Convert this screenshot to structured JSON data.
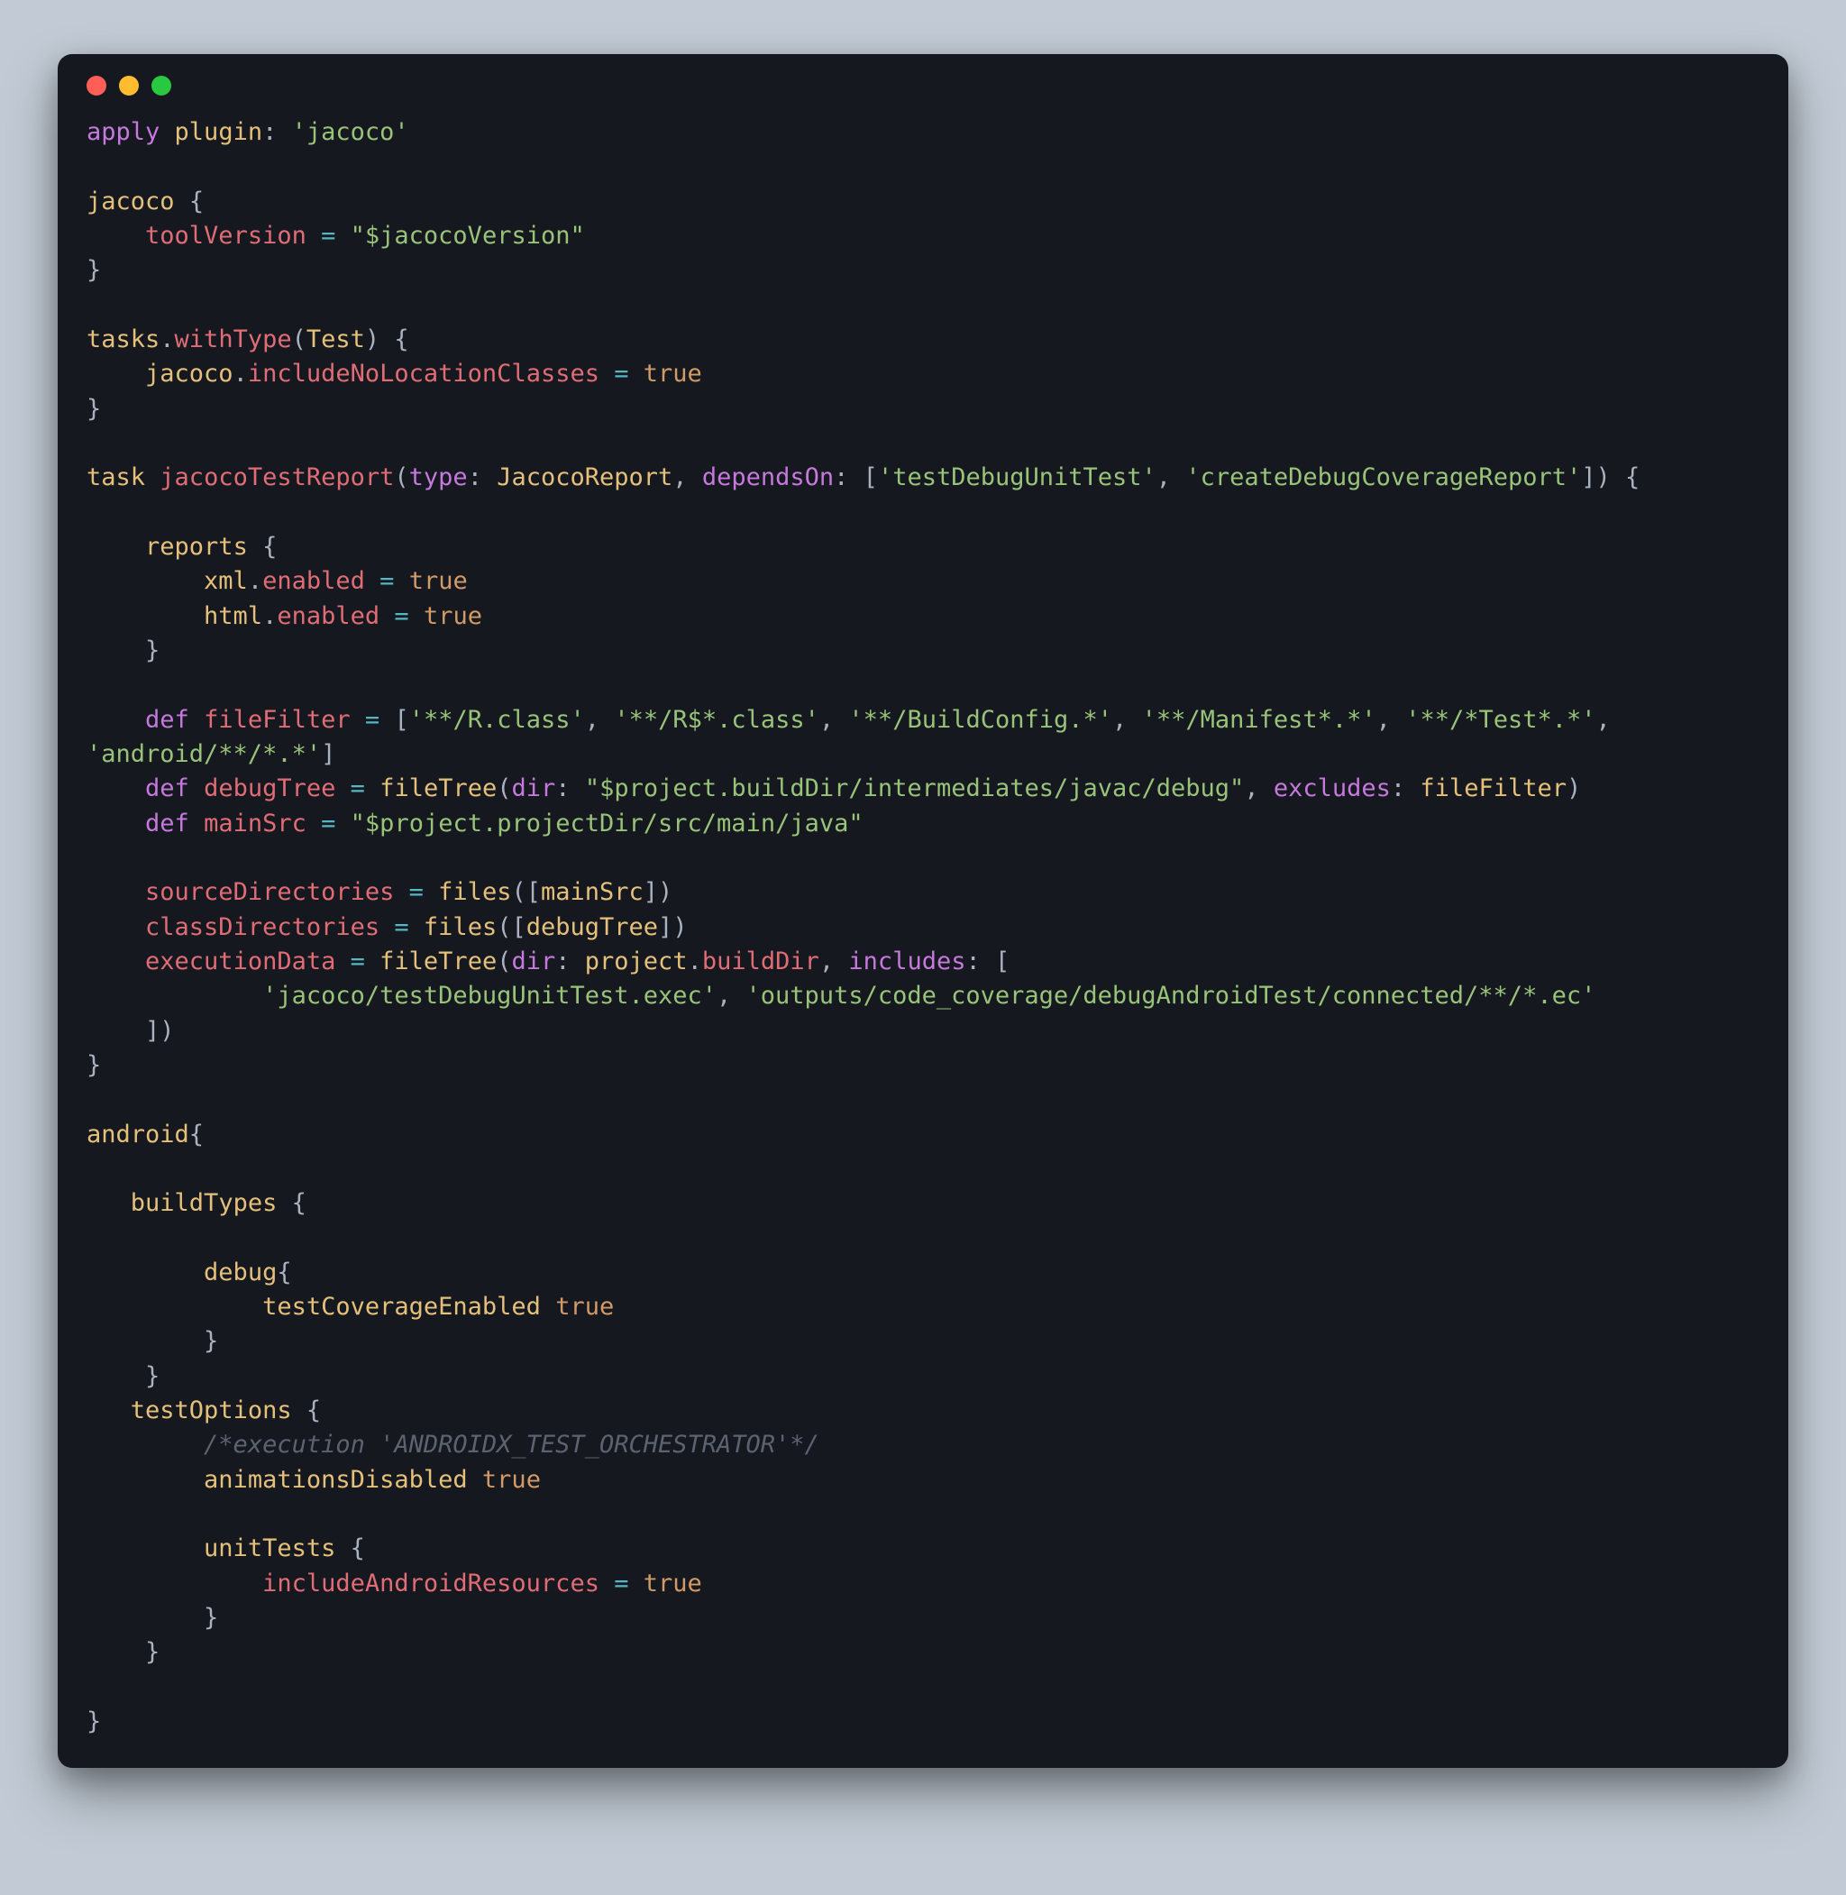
{
  "code": {
    "apply": "apply",
    "plugin_label": "plugin",
    "colon": ":",
    "jacoco_str": "'jacoco'",
    "jacoco_name": "jacoco",
    "lbrace": "{",
    "rbrace": "}",
    "toolVersion": "toolVersion",
    "eq": "=",
    "jacocoVersion_str": "\"$jacocoVersion\"",
    "tasks": "tasks",
    "dot": ".",
    "withType": "withType",
    "Test": "Test",
    "lparen": "(",
    "rparen": ")",
    "includeNoLocationClasses": "includeNoLocationClasses",
    "true": "true",
    "task_kw": "task",
    "jacocoTestReport": "jacocoTestReport",
    "type_kw": "type",
    "JacocoReport": "JacocoReport",
    "comma": ",",
    "dependsOn_kw": "dependsOn",
    "lbracket": "[",
    "rbracket": "]",
    "testDebugUnitTest_str": "'testDebugUnitTest'",
    "createDebugCoverageReport_str": "'createDebugCoverageReport'",
    "reports": "reports",
    "xml": "xml",
    "html": "html",
    "enabled": "enabled",
    "def": "def",
    "fileFilter": "fileFilter",
    "ff1": "'**/R.class'",
    "ff2": "'**/R$*.class'",
    "ff3": "'**/BuildConfig.*'",
    "ff4": "'**/Manifest*.*'",
    "ff5": "'**/*Test*.*'",
    "ff6": "'android/**/*.*'",
    "debugTree": "debugTree",
    "fileTree": "fileTree",
    "dir_kw": "dir",
    "debugTree_str": "\"$project.buildDir/intermediates/javac/debug\"",
    "excludes_kw": "excludes",
    "mainSrc": "mainSrc",
    "mainSrc_str": "\"$project.projectDir/src/main/java\"",
    "sourceDirectories": "sourceDirectories",
    "classDirectories": "classDirectories",
    "files": "files",
    "executionData": "executionData",
    "project": "project",
    "buildDir": "buildDir",
    "includes_kw": "includes",
    "exec_str1": "'jacoco/testDebugUnitTest.exec'",
    "exec_str2": "'outputs/code_coverage/debugAndroidTest/connected/**/*.ec'",
    "android": "android",
    "buildTypes": "buildTypes",
    "debug": "debug",
    "testCoverageEnabled": "testCoverageEnabled",
    "testOptions": "testOptions",
    "comment_orchestrator": "/*execution 'ANDROIDX_TEST_ORCHESTRATOR'*/",
    "animationsDisabled": "animationsDisabled",
    "unitTests": "unitTests",
    "includeAndroidResources": "includeAndroidResources"
  }
}
